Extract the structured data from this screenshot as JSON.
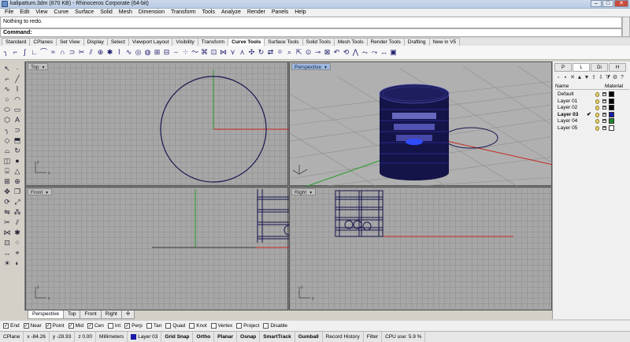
{
  "window": {
    "title": "kalipattum.3dm (870 KB) - Rhinoceros Corporate (64-bit)"
  },
  "menu": [
    "File",
    "Edit",
    "View",
    "Curve",
    "Surface",
    "Solid",
    "Mesh",
    "Dimension",
    "Transform",
    "Tools",
    "Analyze",
    "Render",
    "Panels",
    "Help"
  ],
  "command": {
    "history": "Nothing to redo.",
    "prompt": "Command:"
  },
  "toolbar_tabs": [
    "Standard",
    "CPlanes",
    "Set View",
    "Display",
    "Select",
    "Viewport Layout",
    "Visibility",
    "Transform",
    "Curve Tools",
    "Surface Tools",
    "Solid Tools",
    "Mesh Tools",
    "Render Tools",
    "Drafting",
    "New in V5"
  ],
  "active_toolbar_tab": "Curve Tools",
  "viewports": {
    "top": {
      "label": "Top"
    },
    "perspective": {
      "label": "Perspective"
    },
    "front": {
      "label": "Front"
    },
    "right": {
      "label": "Right"
    }
  },
  "viewport_tabs": [
    "Perspective",
    "Top",
    "Front",
    "Right"
  ],
  "layers_panel": {
    "columns": {
      "name": "Name",
      "material": "Material"
    },
    "layers": [
      {
        "name": "Default",
        "current": false,
        "color": "#000000"
      },
      {
        "name": "Layer 01",
        "current": false,
        "color": "#000000"
      },
      {
        "name": "Layer 02",
        "current": false,
        "color": "#000000"
      },
      {
        "name": "Layer 03",
        "current": true,
        "color": "#1a1aa8"
      },
      {
        "name": "Layer 04",
        "current": false,
        "color": "#1b8a2a"
      },
      {
        "name": "Layer 05",
        "current": false,
        "color": "#ffffff"
      }
    ]
  },
  "osnaps": [
    {
      "label": "End",
      "checked": true
    },
    {
      "label": "Near",
      "checked": true
    },
    {
      "label": "Point",
      "checked": true
    },
    {
      "label": "Mid",
      "checked": true
    },
    {
      "label": "Cen",
      "checked": true
    },
    {
      "label": "Int",
      "checked": false
    },
    {
      "label": "Perp",
      "checked": true
    },
    {
      "label": "Tan",
      "checked": false
    },
    {
      "label": "Quad",
      "checked": false
    },
    {
      "label": "Knot",
      "checked": false
    },
    {
      "label": "Vertex",
      "checked": false
    },
    {
      "label": "Project",
      "checked": false
    },
    {
      "label": "Disable",
      "checked": false
    }
  ],
  "status": {
    "cplane": "CPlane",
    "x": "x -84.26",
    "y": "y -28.93",
    "z": "z 0.00",
    "units": "Millimeters",
    "layer": "Layer 03",
    "panes": [
      "Grid Snap",
      "Ortho",
      "Planar",
      "Osnap",
      "SmartTrack",
      "Gumball",
      "Record History",
      "Filter"
    ],
    "cpu": "CPU use: 5.9 %"
  }
}
